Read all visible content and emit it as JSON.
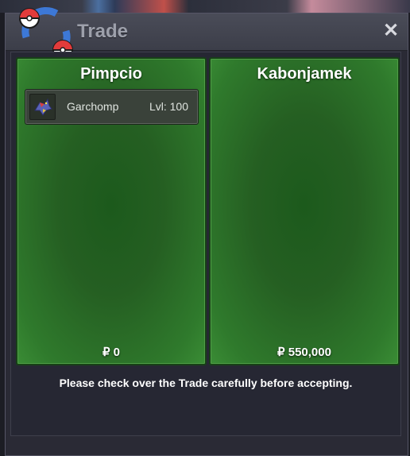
{
  "window": {
    "title": "Trade",
    "close_label": "✕"
  },
  "panels": [
    {
      "player": "Pimpcio",
      "items": [
        {
          "name": "Garchomp",
          "level": "Lvl: 100",
          "icon": "garchomp-sprite-icon"
        }
      ],
      "money": "₽ 0"
    },
    {
      "player": "Kabonjamek",
      "items": [],
      "money": "₽ 550,000"
    }
  ],
  "notice": "Please check over the Trade carefully before accepting.",
  "colors": {
    "panel_green": "#2f7a2c",
    "window_bg": "#2a2a35",
    "titlebar": "#454751"
  }
}
